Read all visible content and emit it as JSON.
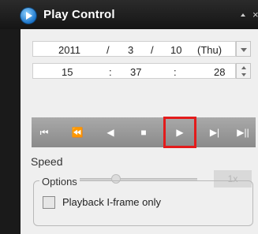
{
  "window": {
    "title": "Play Control",
    "close_glyph": "×"
  },
  "date": {
    "year": "2011",
    "month": "3",
    "day": "10",
    "weekday": "(Thu)",
    "separator": "/"
  },
  "time": {
    "hour": "15",
    "minute": "37",
    "second": "28",
    "separator": ":"
  },
  "toolbar": {
    "buttons": [
      {
        "name": "skip-to-start",
        "glyph": "⏮"
      },
      {
        "name": "step-back",
        "glyph": "⏪"
      },
      {
        "name": "play-reverse",
        "glyph": "◀"
      },
      {
        "name": "stop",
        "glyph": "■"
      },
      {
        "name": "play",
        "glyph": "▶"
      },
      {
        "name": "step-forward",
        "glyph": "▶|"
      },
      {
        "name": "skip-to-end",
        "glyph": "▶||"
      }
    ],
    "highlighted_button": "play",
    "highlight_color": "#e31b1b"
  },
  "speed": {
    "label": "Speed",
    "value": "1x",
    "slider_position_fraction": 0.5
  },
  "options": {
    "legend": "Options",
    "playback_iframe_only": {
      "label": "Playback I-frame only",
      "checked": false
    }
  }
}
